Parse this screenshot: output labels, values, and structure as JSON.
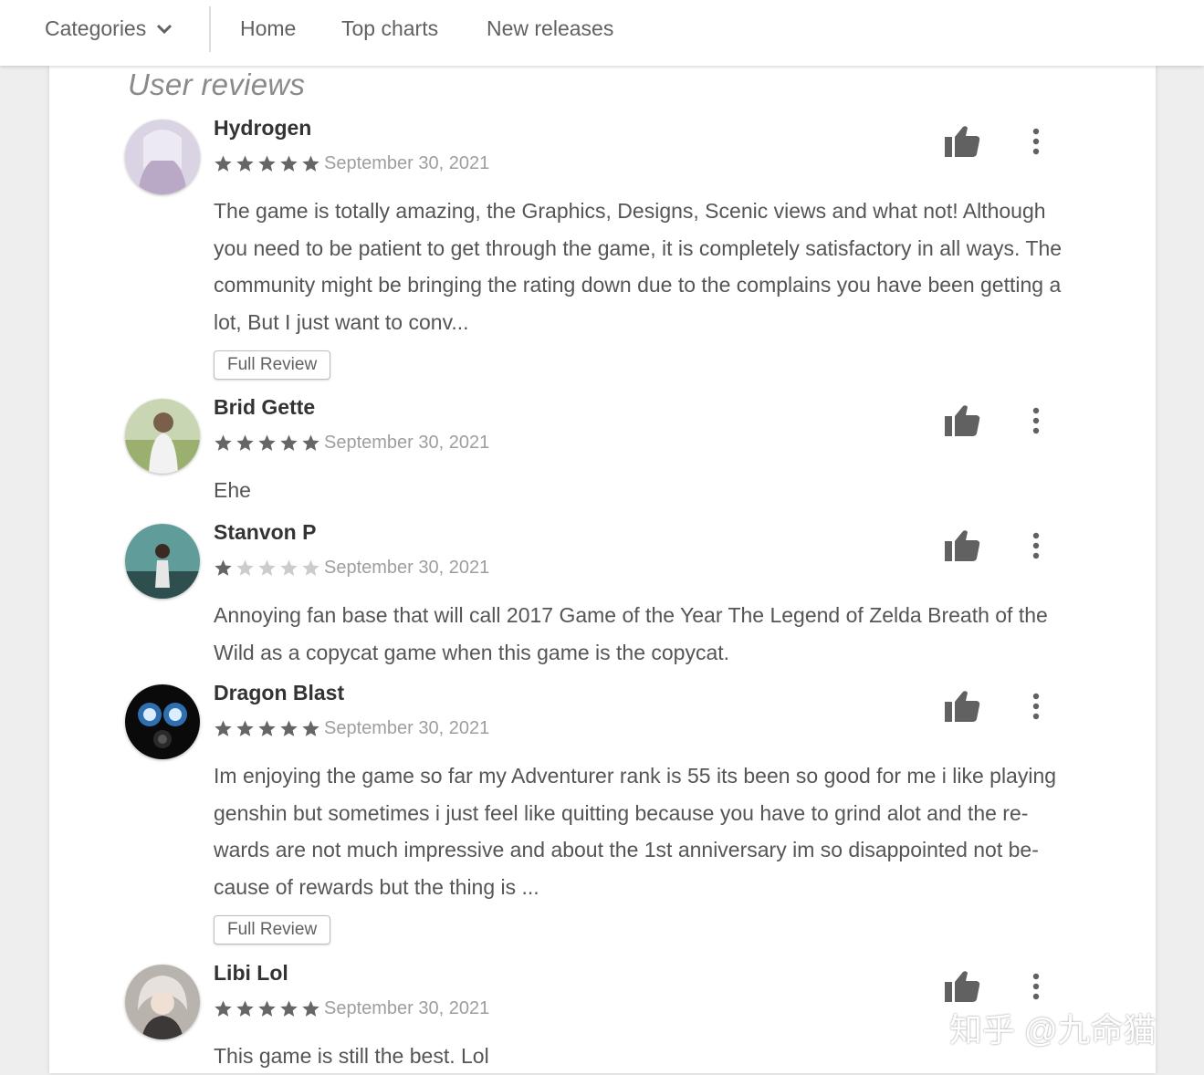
{
  "topbar": {
    "categories_label": "Categories",
    "nav": [
      "Home",
      "Top charts",
      "New releases"
    ]
  },
  "section_title": "User reviews",
  "reviews": [
    {
      "author": "Hydrogen",
      "rating": 5,
      "date": "September 30, 2021",
      "text": "The game is totally amazing, the Graphics, Designs, Scenic views and what not! Although you need to be patient to get through the game, it is completely satisfactory in all ways. The community might be bringing the rating down due to the complains you have been getting a lot, But I just want to conv...",
      "full_review_label": "Full Review"
    },
    {
      "author": "Brid Gette",
      "rating": 5,
      "date": "September 30, 2021",
      "text": "Ehe"
    },
    {
      "author": "Stanvon P",
      "rating": 1,
      "date": "September 30, 2021",
      "text": "Annoying fan base that will call 2017 Game of the Year The Legend of Zelda Breath of the Wild as a copycat game when this game is the copycat."
    },
    {
      "author": "Dragon Blast",
      "rating": 5,
      "date": "September 30, 2021",
      "text": "Im enjoying the game so far my Adventurer rank is 55 its been so good for me i like playing genshin but sometimes i just feel like quitting because you have to grind alot and the re- wards are not much impressive and about the 1st anniversary im so disappointed not be- cause of rewards but the thing is ...",
      "full_review_label": "Full Review"
    },
    {
      "author": "Libi Lol",
      "rating": 5,
      "date": "September 30, 2021",
      "text": "This game is still the best. Lol"
    }
  ],
  "watermark": "知乎 @九命猫",
  "colors": {
    "star_filled": "#666666",
    "star_empty": "#cccccc",
    "icon_gray": "#616161",
    "background": "#eeeeee"
  }
}
